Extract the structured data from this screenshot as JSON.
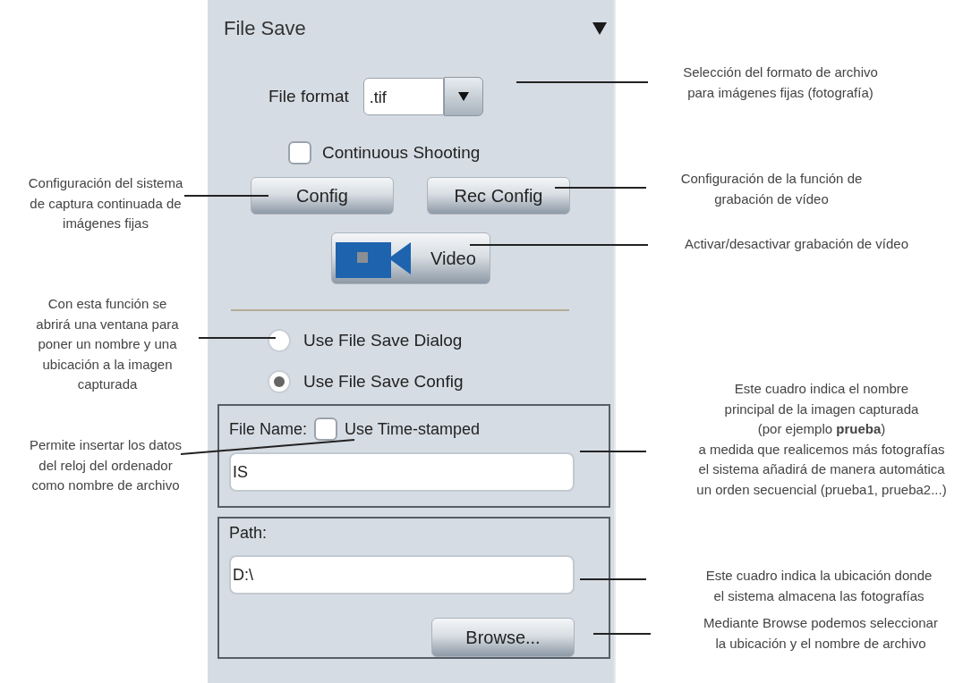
{
  "panel": {
    "title": "File Save",
    "file_format": {
      "label": "File format",
      "value": ".tif"
    },
    "continuous_shooting": {
      "label": "Continuous Shooting",
      "checked": false
    },
    "buttons": [
      "Config",
      "Rec Config"
    ],
    "video_button": {
      "label": "Video"
    },
    "save_modes": [
      {
        "label": "Use File Save Dialog",
        "selected": false
      },
      {
        "label": "Use File Save Config",
        "selected": true
      }
    ],
    "file_name": {
      "label": "File Name:",
      "timestamp": {
        "label": "Use Time-stamped",
        "checked": false
      },
      "value": "IS"
    },
    "path": {
      "label": "Path:",
      "value": "D:\\",
      "browse": "Browse..."
    }
  },
  "annotations": [
    {
      "lines": [
        "Selección del formato de archivo",
        "para imágenes fijas (fotografía)"
      ]
    },
    {
      "lines": [
        "Configuración del sistema",
        "de captura continuada de",
        "imágenes fijas"
      ]
    },
    {
      "lines": [
        "Configuración de la función de",
        "grabación de vídeo"
      ]
    },
    {
      "lines": [
        "Activar/desactivar grabación de vídeo"
      ]
    },
    {
      "lines": [
        "Con esta función se",
        "abrirá una ventana para",
        "poner un nombre y una",
        "ubicación a la imagen",
        "capturada"
      ]
    },
    {
      "lines": [
        "Este cuadro indica el nombre",
        "principal de la imagen capturada",
        "(por ejemplo **prueba**)",
        "a medida que realicemos más fotografías",
        "el sistema añadirá de manera automática",
        "un orden secuencial (prueba1, prueba2...)"
      ]
    },
    {
      "lines": [
        "Permite insertar los datos",
        "del reloj del ordenador",
        "como nombre de archivo"
      ]
    },
    {
      "lines": [
        "Este cuadro indica la ubicación donde",
        "el sistema almacena las fotografías"
      ]
    },
    {
      "lines": [
        "Mediante Browse podemos seleccionar",
        "la ubicación y el nombre de archivo"
      ]
    }
  ]
}
